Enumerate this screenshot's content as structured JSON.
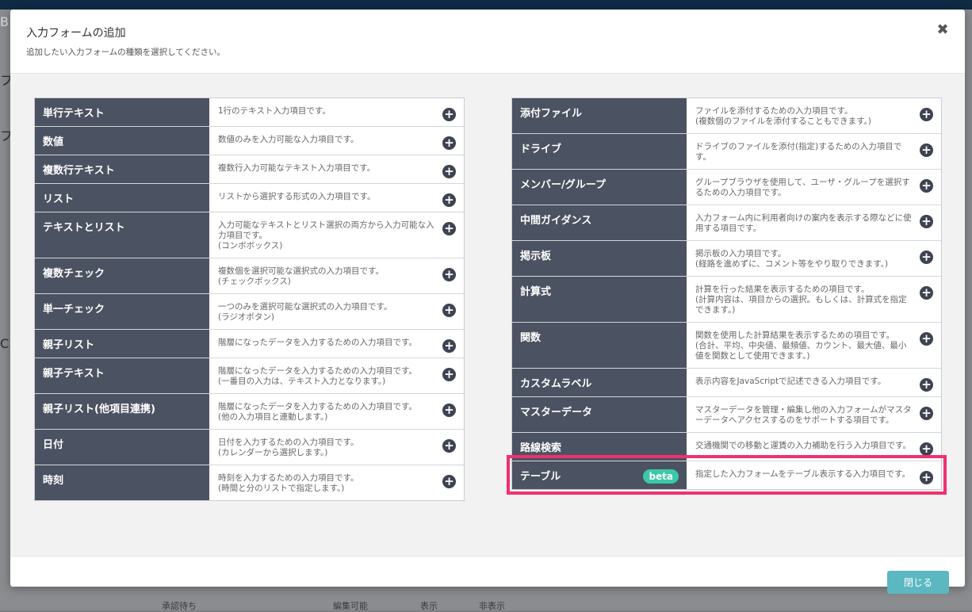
{
  "modal": {
    "title": "入力フォームの追加",
    "subtitle": "追加したい入力フォームの種類を選択してください。",
    "close_glyph": "✖",
    "footer_close_label": "閉じる"
  },
  "left_items": [
    {
      "name": "単行テキスト",
      "desc": "1行のテキスト入力項目です。"
    },
    {
      "name": "数値",
      "desc": "数値のみを入力可能な入力項目です。"
    },
    {
      "name": "複数行テキスト",
      "desc": "複数行入力可能なテキスト入力項目です。"
    },
    {
      "name": "リスト",
      "desc": "リストから選択する形式の入力項目です。"
    },
    {
      "name": "テキストとリスト",
      "desc": "入力可能なテキストとリスト選択の両方から入力可能な入力項目です。\n(コンボボックス)"
    },
    {
      "name": "複数チェック",
      "desc": "複数個を選択可能な選択式の入力項目です。\n(チェックボックス)"
    },
    {
      "name": "単一チェック",
      "desc": "一つのみを選択可能な選択式の入力項目です。\n(ラジオボタン)"
    },
    {
      "name": "親子リスト",
      "desc": "階層になったデータを入力するための入力項目です。"
    },
    {
      "name": "親子テキスト",
      "desc": "階層になったデータを入力するための入力項目です。\n(一番目の入力は、テキスト入力となります。)"
    },
    {
      "name": "親子リスト(他項目連携)",
      "desc": "階層になったデータを入力するための入力項目です。\n(他の入力項目と連動します。)"
    },
    {
      "name": "日付",
      "desc": "日付を入力するための入力項目です。\n(カレンダーから選択します。)"
    },
    {
      "name": "時刻",
      "desc": "時刻を入力するための入力項目です。\n(時間と分のリストで指定します。)"
    }
  ],
  "right_items": [
    {
      "name": "添付ファイル",
      "desc": "ファイルを添付するための入力項目です。\n(複数個のファイルを添付することもできます。)"
    },
    {
      "name": "ドライブ",
      "desc": "ドライブのファイルを添付(指定)するための入力項目です。"
    },
    {
      "name": "メンバー/グループ",
      "desc": "グループブラウザを使用して、ユーザ・グループを選択するための入力項目です。"
    },
    {
      "name": "中間ガイダンス",
      "desc": "入力フォーム内に利用者向けの案内を表示する際などに使用する項目です。"
    },
    {
      "name": "掲示板",
      "desc": "掲示板の入力項目です。\n(経路を進めずに、コメント等をやり取りできます。)"
    },
    {
      "name": "計算式",
      "desc": "計算を行った結果を表示するための項目です。\n(計算内容は、項目からの選択。もしくは、計算式を指定できます。)"
    },
    {
      "name": "関数",
      "desc": "関数を使用した計算結果を表示するための項目です。\n(合計、平均、中央値、最頻値、カウント、最大値、最小値を関数として使用できます。)"
    },
    {
      "name": "カスタムラベル",
      "desc": "表示内容をJavaScriptで記述できる入力項目です。"
    },
    {
      "name": "マスターデータ",
      "desc": "マスターデータを管理・編集し他の入力フォームがマスターデータへアクセスするのをサポートする項目です。"
    },
    {
      "name": "路線検索",
      "desc": "交通機関での移動と運賃の入力補助を行う入力項目です。"
    },
    {
      "name": "テーブル",
      "desc": "指定した入力フォームをテーブル表示する入力項目です。",
      "badge": "beta",
      "highlight": true
    }
  ],
  "add_glyph": "+",
  "background": {
    "edge_glyphs": [
      "B",
      "フ",
      "フ",
      "C"
    ],
    "bottom_texts": [
      "承認待ち",
      "編集可能",
      "表示",
      "非表示"
    ]
  }
}
